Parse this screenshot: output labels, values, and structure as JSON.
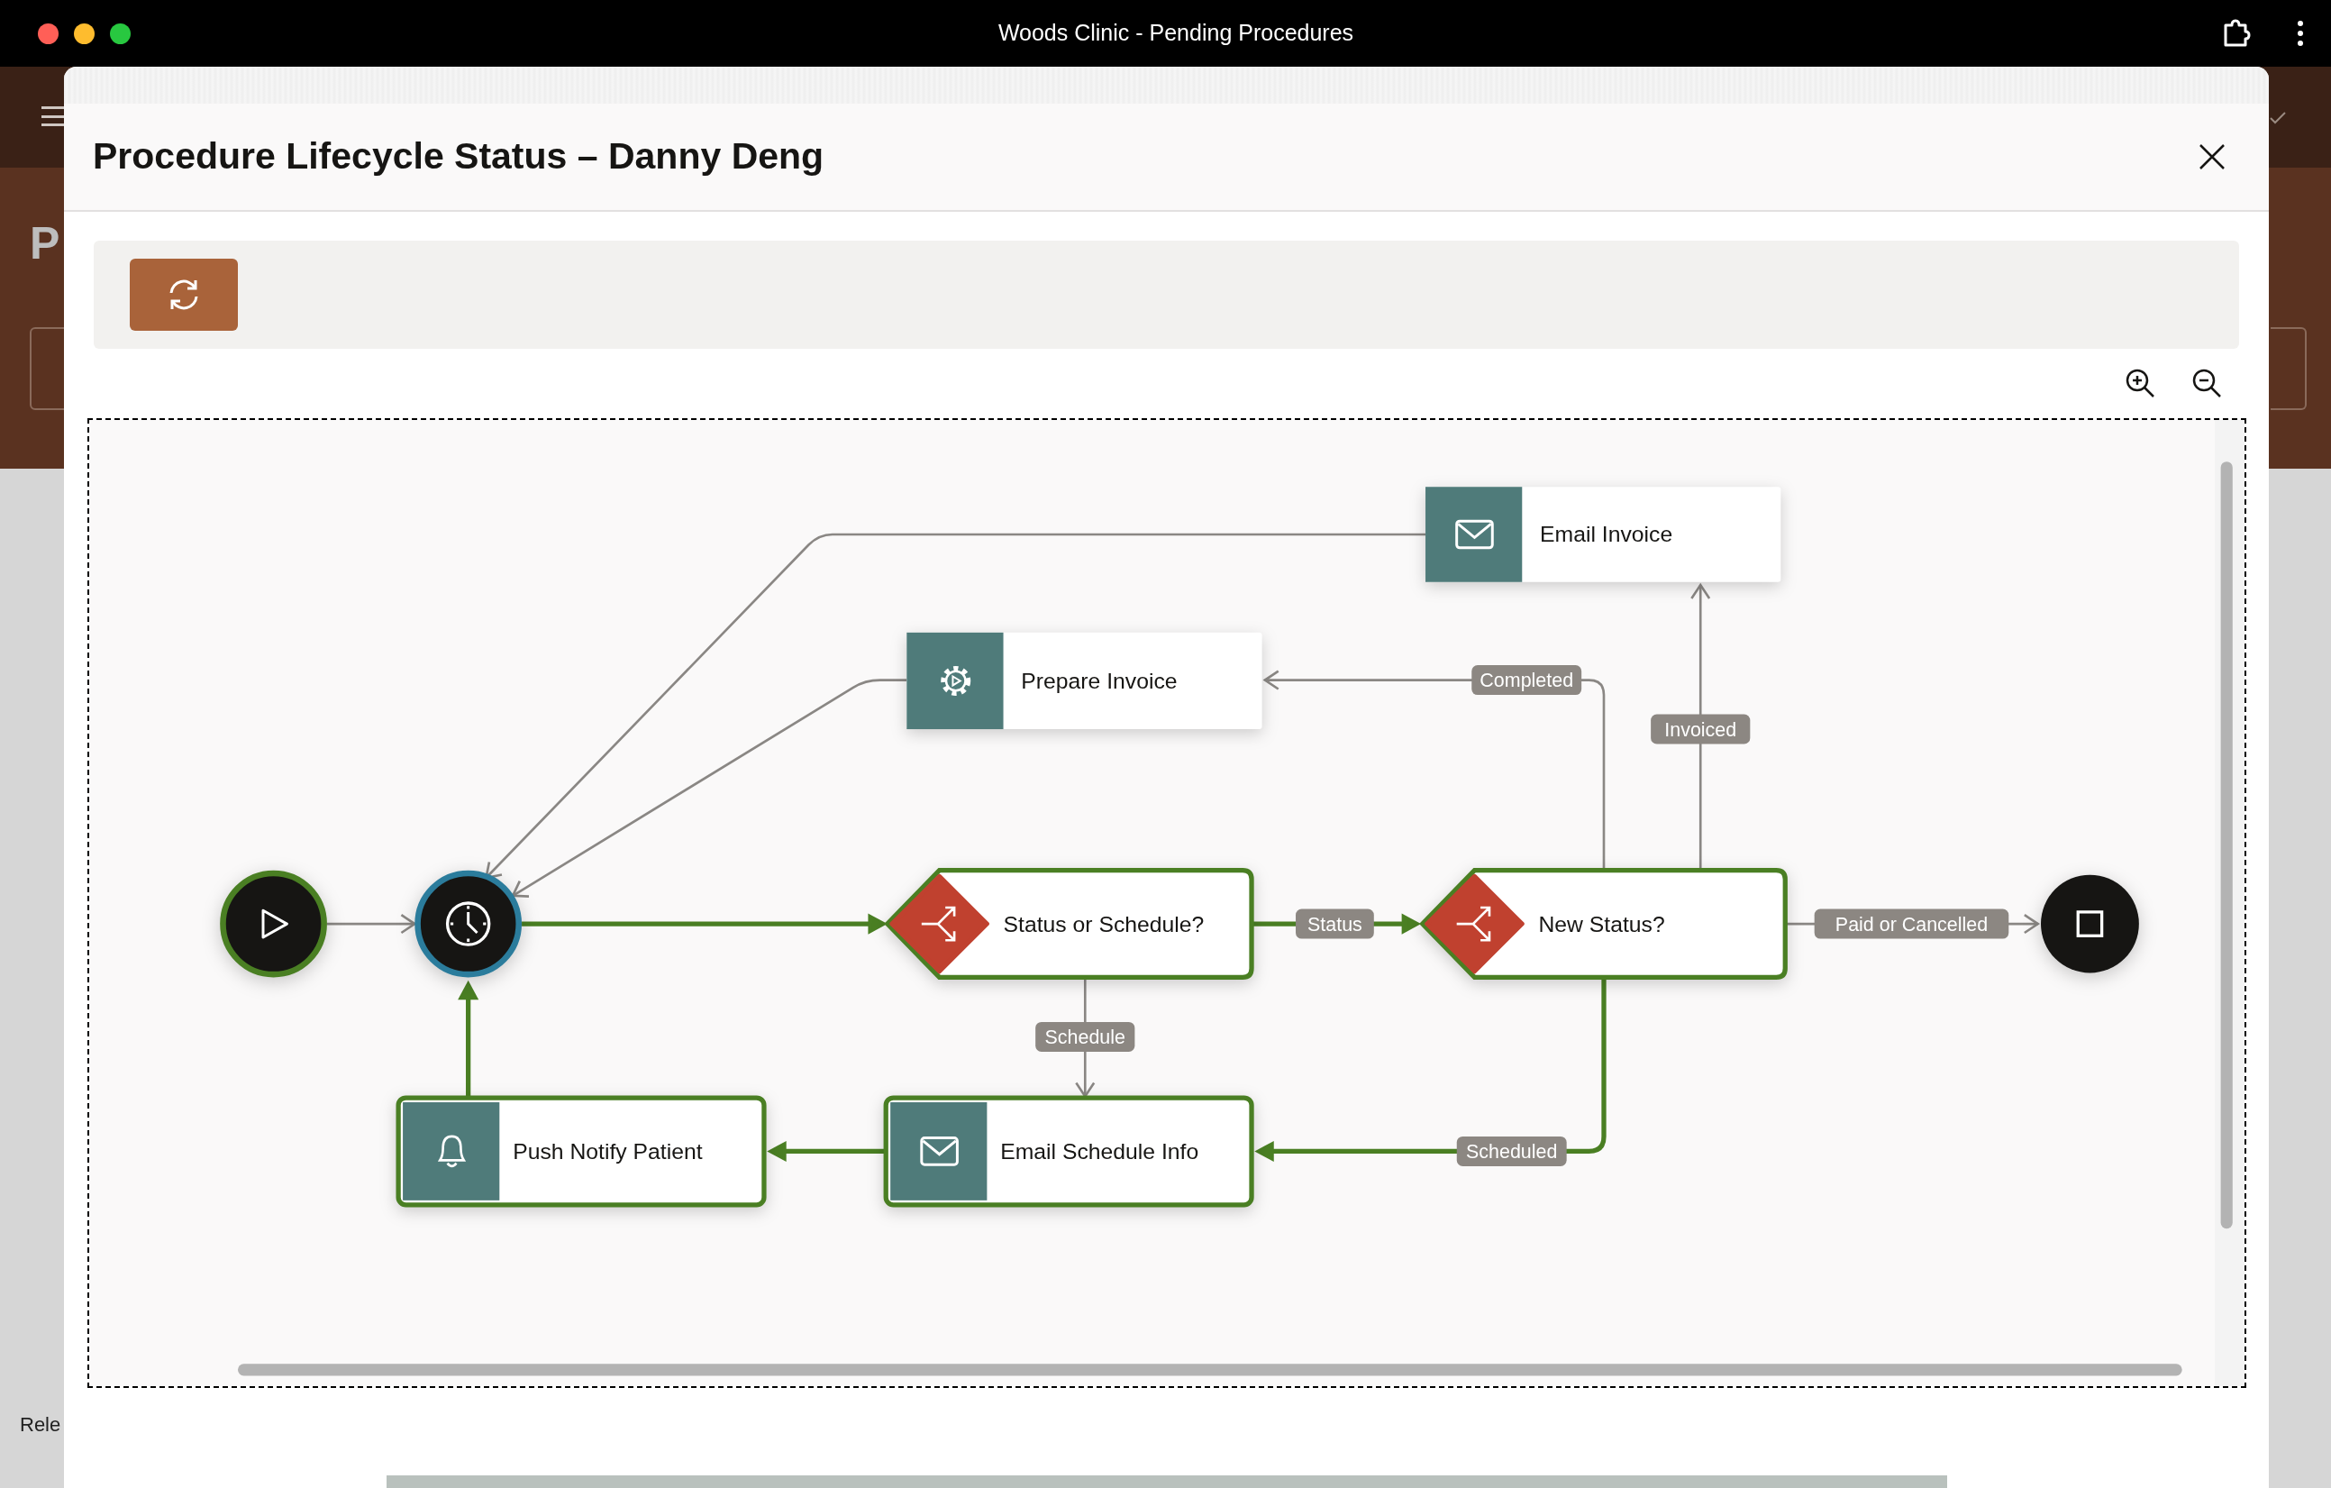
{
  "window": {
    "title": "Woods Clinic - Pending Procedures"
  },
  "background": {
    "heading": "P",
    "footer_text": "Rele"
  },
  "dialog": {
    "title": "Procedure Lifecycle Status – Danny Deng"
  },
  "diagram": {
    "nodes": [
      {
        "kind": "email_task",
        "label": "Email Invoice",
        "completed": false,
        "current": false
      },
      {
        "kind": "service_task",
        "label": "Prepare Invoice",
        "completed": false,
        "current": false
      },
      {
        "kind": "start",
        "completed": true,
        "current": false
      },
      {
        "kind": "timer",
        "completed": false,
        "current": true
      },
      {
        "kind": "gateway",
        "label": "Status or Schedule?",
        "completed": true,
        "current": false
      },
      {
        "kind": "gateway",
        "label": "New Status?",
        "completed": true,
        "current": false
      },
      {
        "kind": "end",
        "completed": false,
        "current": false
      },
      {
        "kind": "notify_task",
        "label": "Push Notify Patient",
        "completed": true,
        "current": false
      },
      {
        "kind": "email_task",
        "label": "Email Schedule Info",
        "completed": true,
        "current": false
      }
    ],
    "edges": [
      {
        "active": false
      },
      {
        "active": true
      },
      {
        "label": "Status",
        "active": true
      },
      {
        "label": "Paid or Cancelled",
        "active": false
      },
      {
        "label": "Schedule",
        "active": false
      },
      {
        "label": "Scheduled",
        "active": true
      },
      {
        "label": "Completed",
        "active": false
      },
      {
        "label": "Invoiced",
        "active": false
      },
      {
        "active": true
      },
      {
        "active": true
      },
      {
        "active": false
      },
      {
        "active": false
      }
    ]
  }
}
